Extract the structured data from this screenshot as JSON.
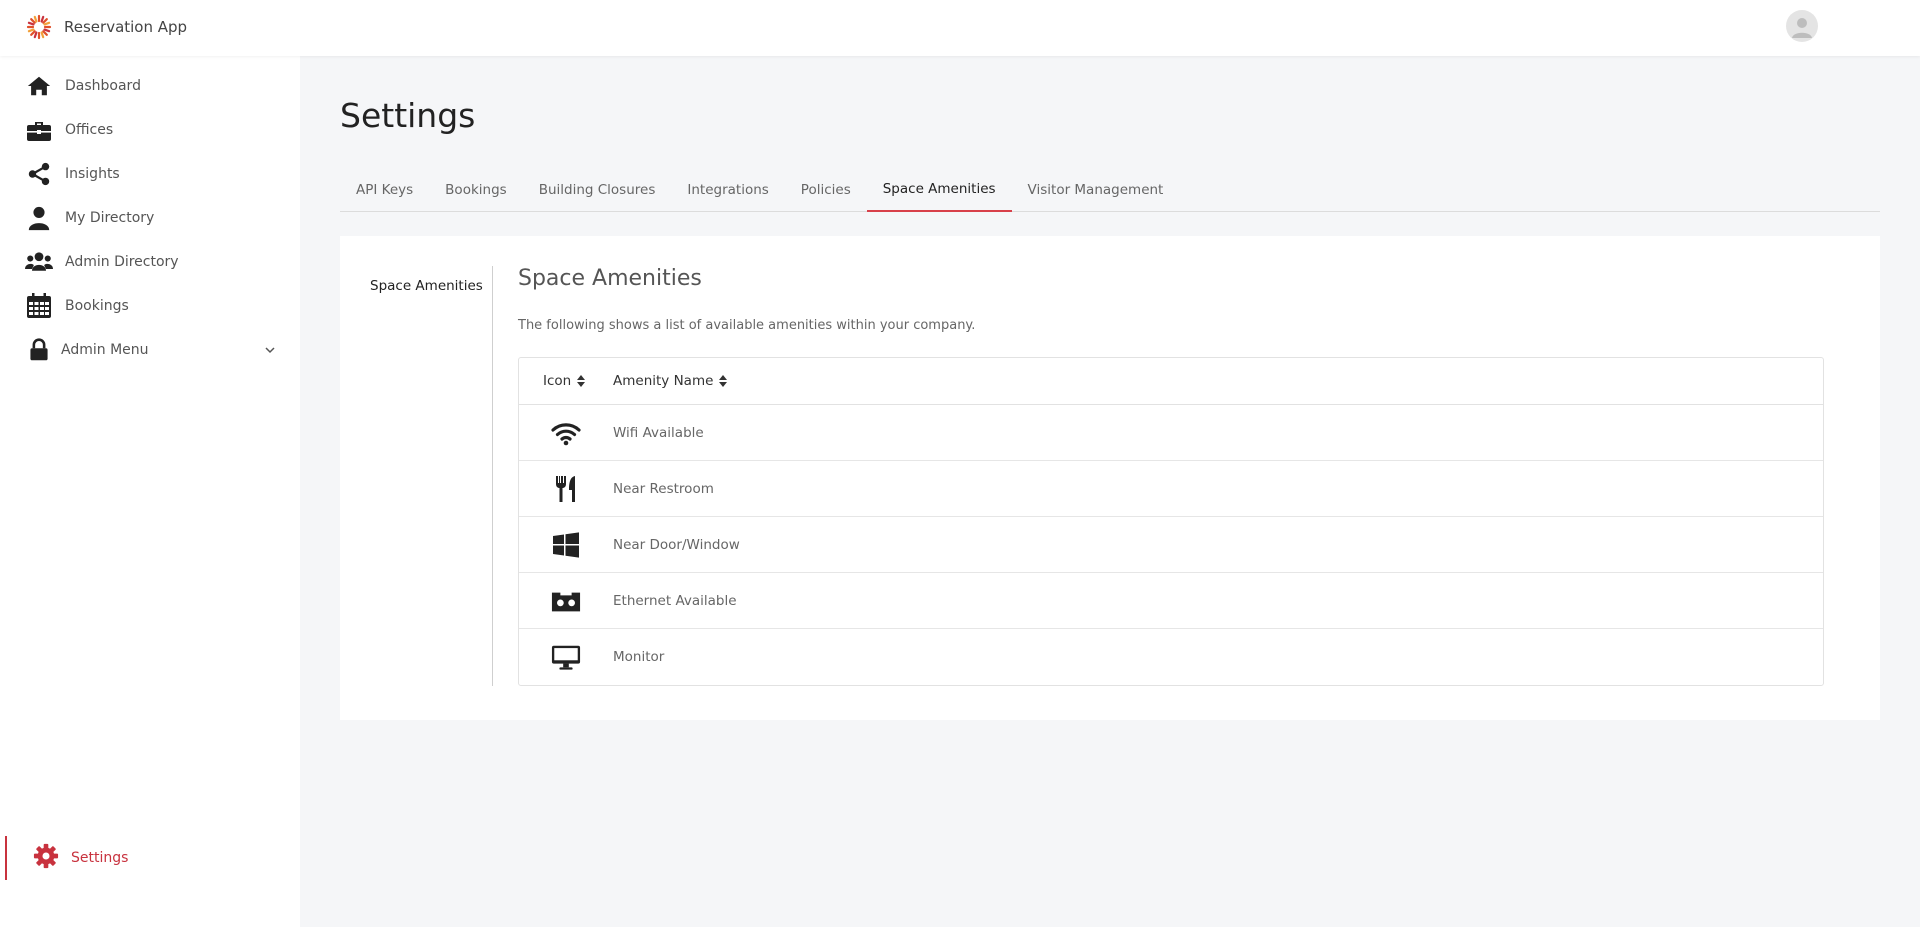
{
  "app": {
    "name": "Reservation App"
  },
  "sidebar": {
    "items": [
      {
        "label": "Dashboard",
        "icon": "home-icon"
      },
      {
        "label": "Offices",
        "icon": "briefcase-icon"
      },
      {
        "label": "Insights",
        "icon": "share-icon"
      },
      {
        "label": "My Directory",
        "icon": "user-icon"
      },
      {
        "label": "Admin Directory",
        "icon": "users-icon"
      },
      {
        "label": "Bookings",
        "icon": "calendar-icon"
      },
      {
        "label": "Admin Menu",
        "icon": "lock-icon"
      }
    ],
    "settings_label": "Settings"
  },
  "page": {
    "title": "Settings"
  },
  "tabs": [
    {
      "label": "API Keys"
    },
    {
      "label": "Bookings"
    },
    {
      "label": "Building Closures"
    },
    {
      "label": "Integrations"
    },
    {
      "label": "Policies"
    },
    {
      "label": "Space Amenities",
      "active": true
    },
    {
      "label": "Visitor Management"
    }
  ],
  "content": {
    "subnav_label": "Space Amenities",
    "section_title": "Space Amenities",
    "description": "The following shows a list of available amenities within your company.",
    "table": {
      "columns": [
        "Icon",
        "Amenity Name"
      ],
      "rows": [
        {
          "icon": "wifi-icon",
          "name": "Wifi Available"
        },
        {
          "icon": "utensils-icon",
          "name": "Near Restroom"
        },
        {
          "icon": "windows-icon",
          "name": "Near Door/Window"
        },
        {
          "icon": "ethernet-icon",
          "name": "Ethernet Available"
        },
        {
          "icon": "monitor-icon",
          "name": "Monitor"
        }
      ]
    }
  },
  "colors": {
    "accent": "#c8323e",
    "tab_underline": "#d8404a",
    "icon": "#222222"
  }
}
